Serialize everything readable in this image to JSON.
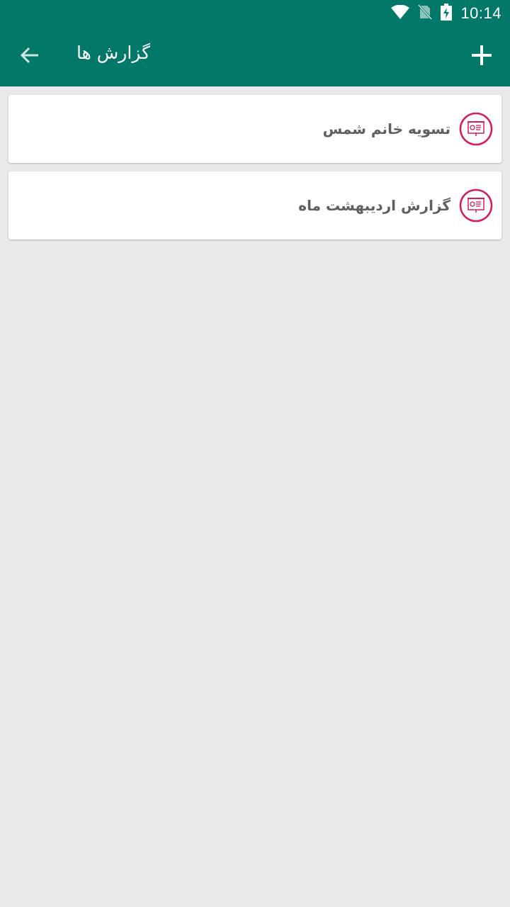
{
  "status_bar": {
    "time": "10:14",
    "icons": [
      "wifi-icon",
      "no-sim-icon",
      "battery-charging-icon"
    ]
  },
  "app_bar": {
    "title": "گزارش ها",
    "back_icon": "arrow-back-icon",
    "add_icon": "plus-icon"
  },
  "reports": [
    {
      "label": "تسویه خانم شمس",
      "icon": "report-presentation-icon"
    },
    {
      "label": "گزارش اردیبهشت ماه",
      "icon": "report-presentation-icon"
    }
  ],
  "colors": {
    "primary": "#017868",
    "accent": "#d81b60",
    "background": "#e9e9e9",
    "card": "#ffffff",
    "text_secondary": "#5f5f5f"
  }
}
